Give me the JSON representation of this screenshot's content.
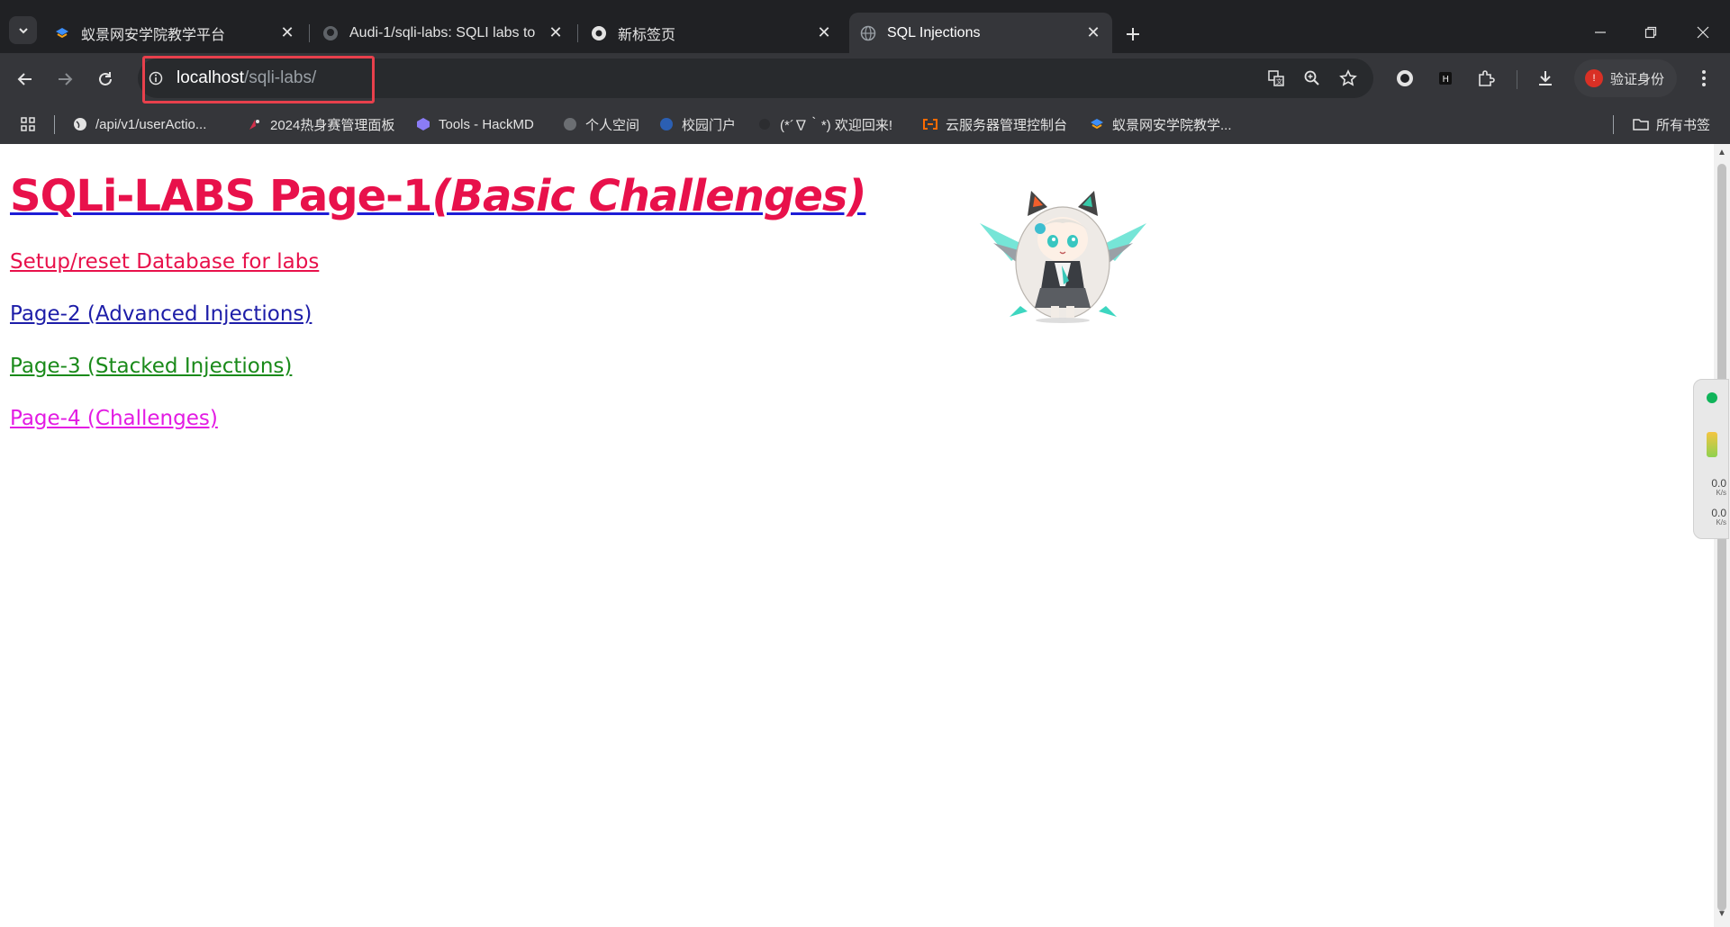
{
  "tabs": [
    {
      "title": "蚁景网安学院教学平台",
      "icon": "antscan-logo-icon"
    },
    {
      "title": "Audi-1/sqli-labs: SQLI labs to",
      "icon": "github-icon"
    },
    {
      "title": "新标签页",
      "icon": "chrome-icon"
    },
    {
      "title": "SQL Injections",
      "icon": "globe-icon",
      "active": true
    }
  ],
  "address_bar": {
    "host": "localhost",
    "path": "/sqli-labs/"
  },
  "profile_button": {
    "label": "验证身份",
    "initial": "!"
  },
  "bookmarks": [
    {
      "label": "/api/v1/userActio...",
      "icon": "globe-icon"
    },
    {
      "label": "2024热身赛管理面板",
      "icon": "ctf-icon"
    },
    {
      "label": "Tools - HackMD",
      "icon": "hackmd-icon"
    },
    {
      "label": "个人空间",
      "icon": "globe-icon"
    },
    {
      "label": "校园门户",
      "icon": "campus-icon"
    },
    {
      "label": "(*´∇｀*) 欢迎回来!",
      "icon": "blank-icon"
    },
    {
      "label": "云服务器管理控制台",
      "icon": "aliyun-icon"
    },
    {
      "label": "蚁景网安学院教学...",
      "icon": "antscan-logo-icon"
    }
  ],
  "all_bookmarks_label": "所有书签",
  "page": {
    "heading_main": "SQLi-LABS Page-1",
    "heading_sub": "(Basic Challenges)",
    "links": [
      {
        "label": "Setup/reset Database for labs",
        "color": "#e8114b"
      },
      {
        "label": "Page-2 (Advanced Injections)",
        "color": "#1d1da8"
      },
      {
        "label": "Page-3 (Stacked Injections)",
        "color": "#1a8a1a"
      },
      {
        "label": "Page-4 (Challenges)",
        "color": "#e31be3"
      }
    ]
  },
  "net_widget": {
    "up_speed": "0.0",
    "up_unit": "K/s",
    "down_speed": "0.0",
    "down_unit": "K/s"
  }
}
